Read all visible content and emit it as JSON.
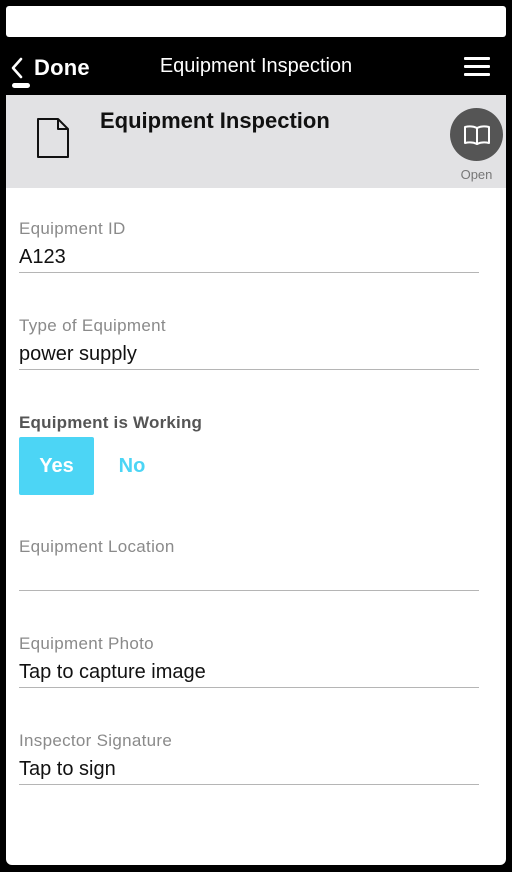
{
  "nav": {
    "back_label": "Done",
    "title": "Equipment Inspection"
  },
  "header": {
    "title": "Equipment Inspection",
    "open_label": "Open"
  },
  "fields": [
    {
      "label": "Equipment ID",
      "value": "A123"
    },
    {
      "label": "Type of Equipment",
      "value": "power supply"
    },
    {
      "label": "Equipment Location",
      "value": ""
    },
    {
      "label": "Equipment Photo",
      "value": "Tap to capture image"
    },
    {
      "label": "Inspector Signature",
      "value": "Tap to sign"
    }
  ],
  "working_toggle": {
    "label": "Equipment is Working",
    "yes_label": "Yes",
    "no_label": "No",
    "selected": "Yes"
  },
  "colors": {
    "accent": "#4cd5f5",
    "header_bg": "#e2e2e4",
    "nav_bg": "#000000"
  },
  "icons": {
    "back": "chevron-left-icon",
    "menu": "hamburger-menu-icon",
    "document": "document-icon",
    "open": "open-book-icon"
  }
}
